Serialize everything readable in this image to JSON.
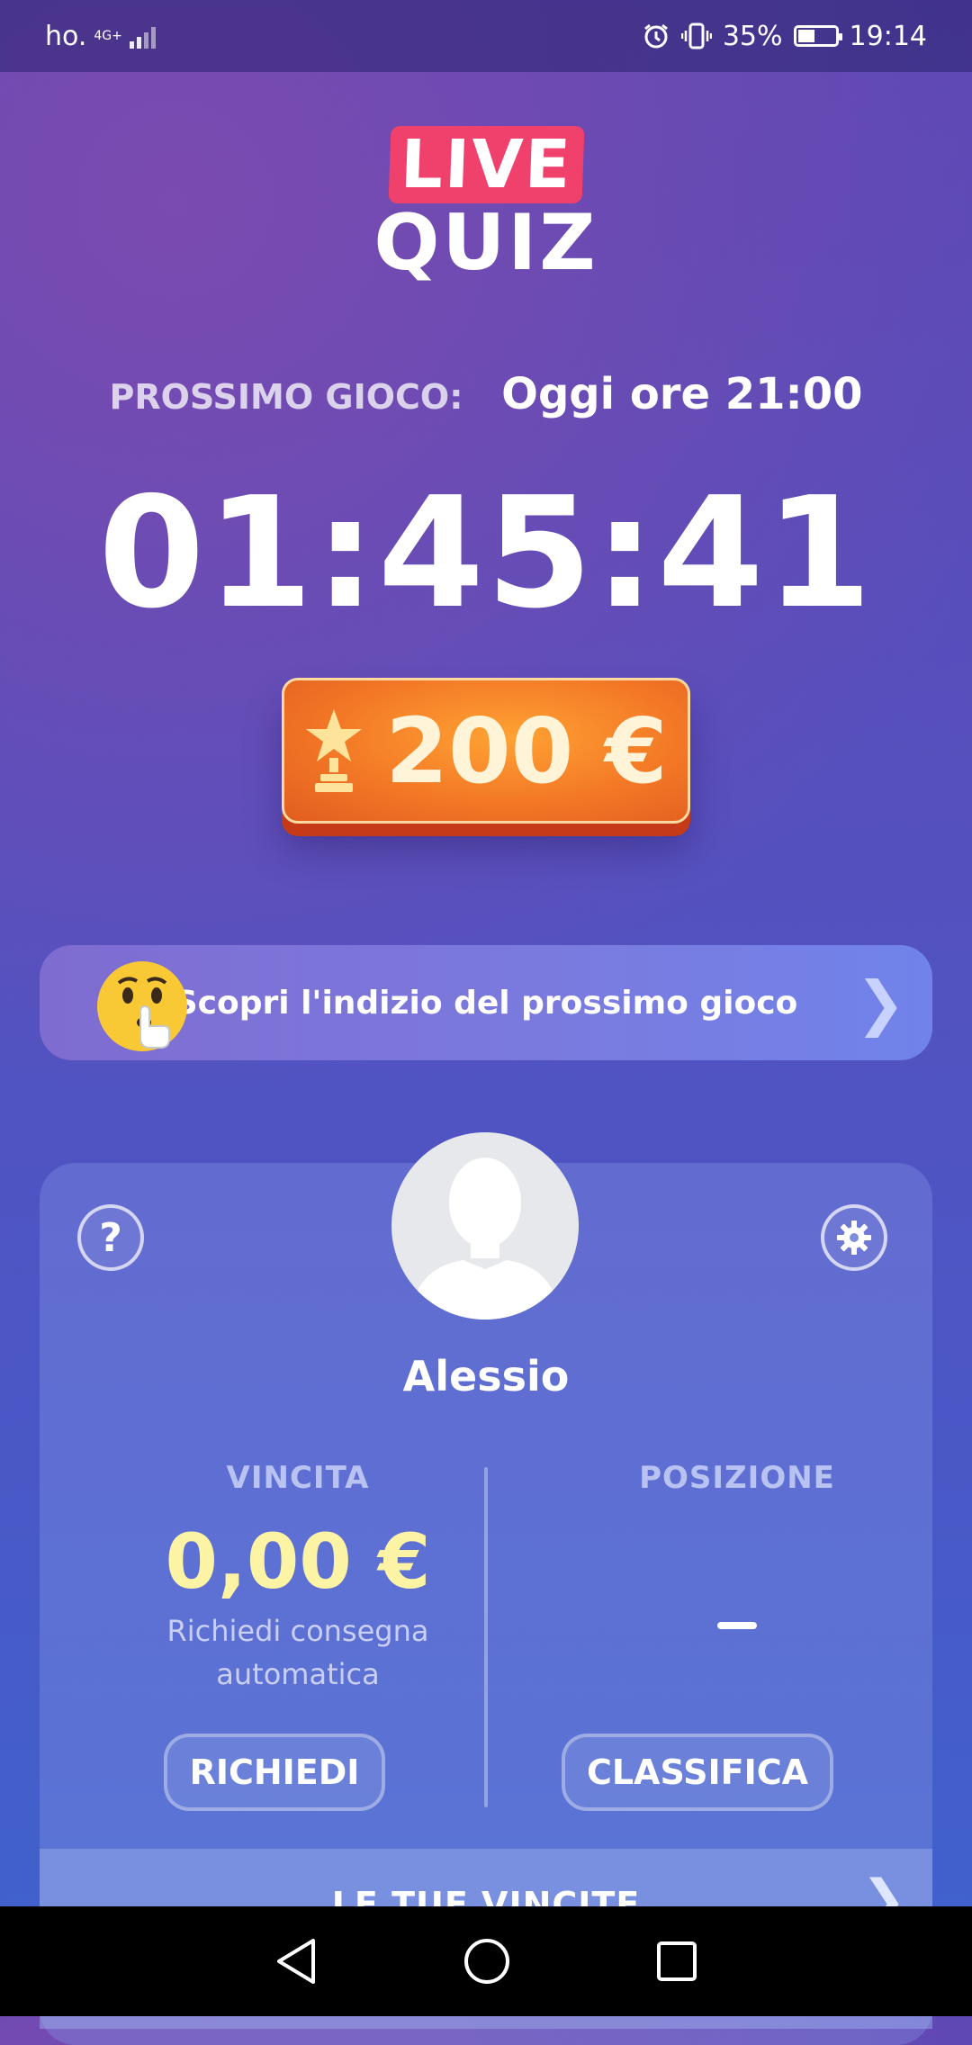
{
  "status_bar": {
    "carrier": "ho.",
    "network": "4G+",
    "battery": "35%",
    "time": "19:14",
    "icons": [
      "signal-icon",
      "alarm-icon",
      "vibrate-icon",
      "battery-icon"
    ]
  },
  "logo": {
    "live": "LIVE",
    "quiz": "QUIZ"
  },
  "next_game": {
    "label": "PROSSIMO GIOCO:",
    "value": "Oggi ore 21:00"
  },
  "countdown": "01:45:41",
  "prize": {
    "amount": "200 €",
    "icon": "trophy-star-icon"
  },
  "hint": {
    "text": "Scopri l'indizio del prossimo gioco",
    "icon": "shushing-face-icon"
  },
  "profile": {
    "help": "?",
    "username": "Alessio",
    "winnings": {
      "title": "VINCITA",
      "value": "0,00 €",
      "subtitle_line1": "Richiedi consegna",
      "subtitle_line2": "automatica",
      "button": "RICHIEDI"
    },
    "position": {
      "title": "POSIZIONE",
      "value": "–",
      "button": "CLASSIFICA"
    },
    "your_wins": "LE TUE VINCITE"
  },
  "colors": {
    "accent_live": "#f0406c",
    "prize_orange": "#f37826",
    "winnings_yellow": "#fdf3a4"
  }
}
